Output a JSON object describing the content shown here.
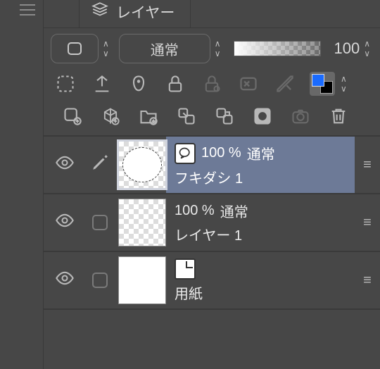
{
  "panel": {
    "title": "レイヤー"
  },
  "blend": {
    "mode": "通常"
  },
  "opacity": {
    "value": "100"
  },
  "layers": [
    {
      "opacity_text": "100 %",
      "mode": "通常",
      "name": "フキダシ 1"
    },
    {
      "opacity_text": "100 %",
      "mode": "通常",
      "name": "レイヤー 1"
    },
    {
      "name": "用紙"
    }
  ],
  "icons": {
    "layers": "layers-icon",
    "menu": "menu-icon"
  }
}
